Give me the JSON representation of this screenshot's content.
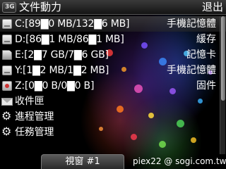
{
  "header": {
    "app_icon_label": "3G",
    "title": "文件動力",
    "exit_label": "退出"
  },
  "list": {
    "items": [
      {
        "icon": "phone-memory-icon",
        "label": "C:[89▇0 MB/132▇6 MB]",
        "type": "手機記憶體"
      },
      {
        "icon": "cache-drive-icon",
        "label": "D:[86▇1 MB/86▇1 MB]",
        "type": "緩存"
      },
      {
        "icon": "memory-card-icon",
        "label": "E:[2▇7 GB/7▇6 GB]",
        "type": "記憶卡"
      },
      {
        "icon": "phone-memory-icon",
        "label": "Y:[1▇2 MB/1▇2 MB]",
        "type": "手機記憶體"
      },
      {
        "icon": "firmware-lock-icon",
        "label": "Z:[0▇0 B/0▇0 B]",
        "type": "固件"
      },
      {
        "icon": "inbox-mail-icon",
        "label": "收件匣",
        "type": ""
      },
      {
        "icon": "gear-icon",
        "label": "進程管理",
        "type": ""
      },
      {
        "icon": "gear-icon",
        "label": "任務管理",
        "type": ""
      }
    ]
  },
  "bottom": {
    "view_tab_label": "視窗 #1",
    "credit_text": "piex22 @ sogi.com.tw"
  },
  "colors": {
    "selected_row_bg": "#4a4a4a",
    "text": "#ffffff"
  }
}
